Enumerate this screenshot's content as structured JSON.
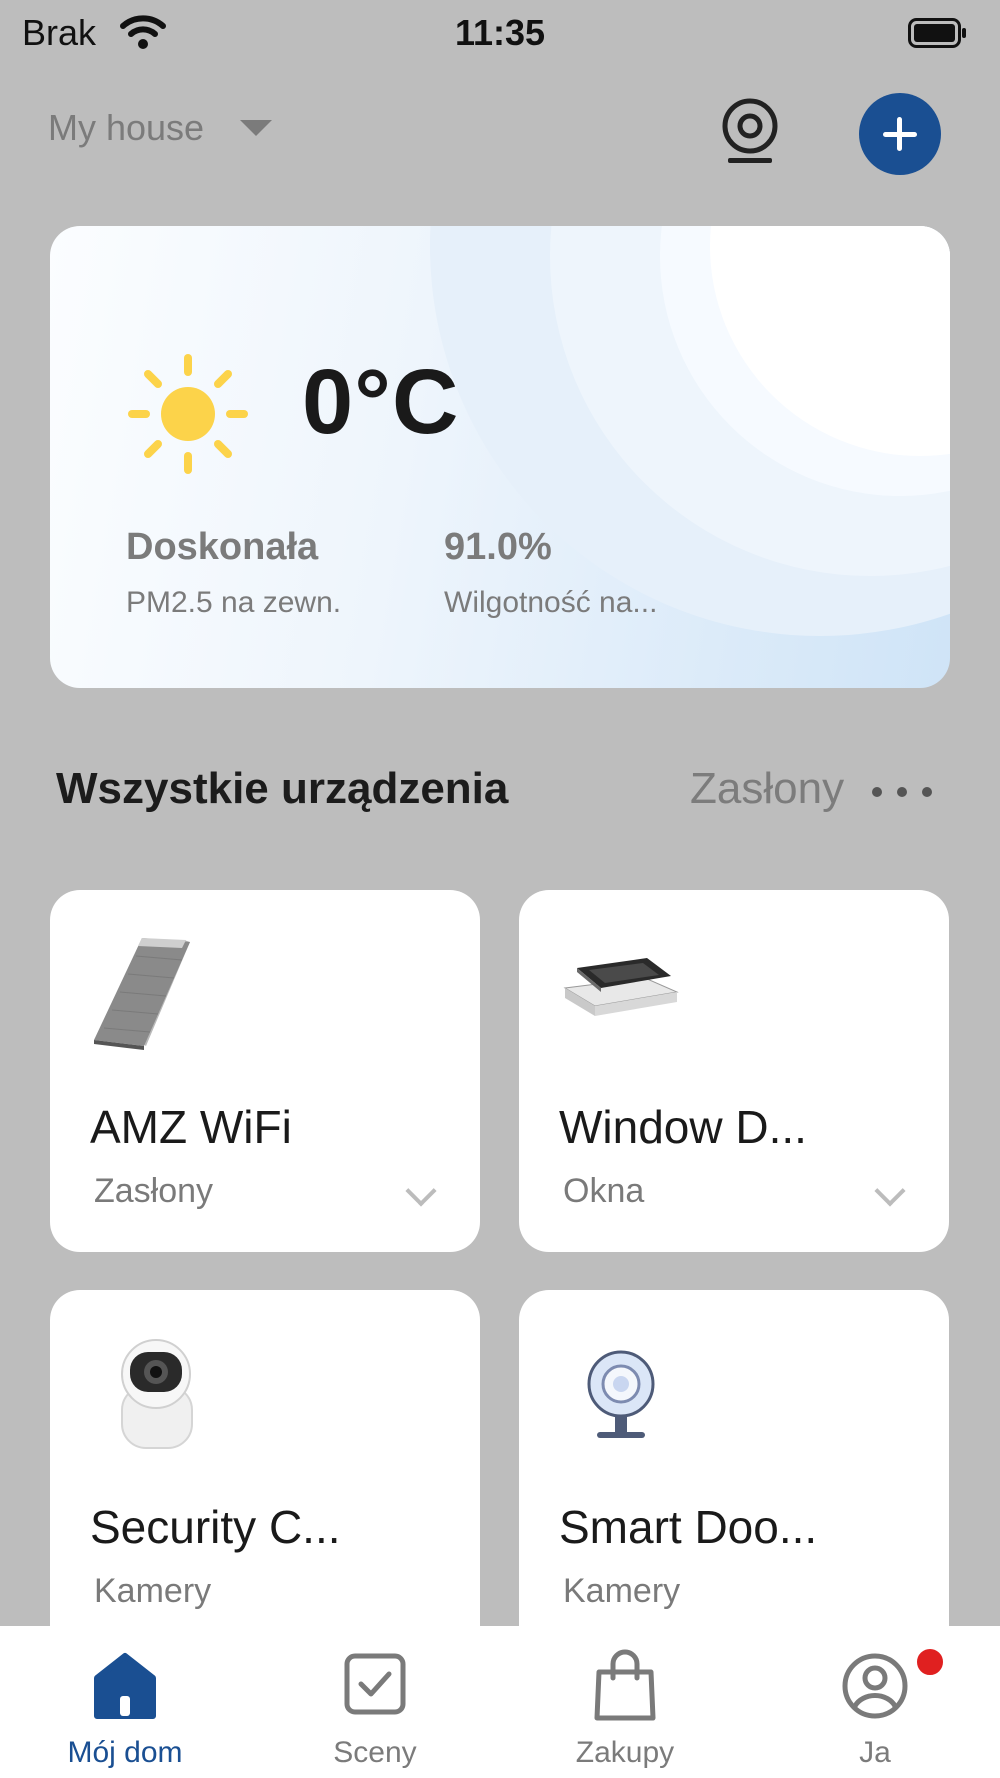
{
  "status_bar": {
    "carrier": "Brak",
    "time": "11:35"
  },
  "header": {
    "house_name": "My house"
  },
  "weather": {
    "temperature": "0°C",
    "air_quality_value": "Doskonała",
    "air_quality_label": "PM2.5 na zewn.",
    "humidity_value": "91.0%",
    "humidity_label": "Wilgotność na..."
  },
  "devices_section": {
    "title": "Wszystkie urządzenia",
    "filter_tab": "Zasłony"
  },
  "devices": [
    {
      "name": "AMZ WiFi",
      "category": "Zasłony",
      "icon": "roller-shutter-icon"
    },
    {
      "name": "Window D...",
      "category": "Okna",
      "icon": "window-icon"
    },
    {
      "name": "Security C...",
      "category": "Kamery",
      "icon": "security-camera-icon"
    },
    {
      "name": "Smart Doo...",
      "category": "Kamery",
      "icon": "webcam-icon"
    }
  ],
  "tabbar": {
    "items": [
      {
        "label": "Mój dom",
        "icon": "home-icon"
      },
      {
        "label": "Sceny",
        "icon": "scenes-checkbox-icon"
      },
      {
        "label": "Zakupy",
        "icon": "shopping-bag-icon"
      },
      {
        "label": "Ja",
        "icon": "profile-icon"
      }
    ]
  },
  "colors": {
    "accent": "#1a4f92",
    "background": "#bdbdbd",
    "badge": "#e02020"
  }
}
